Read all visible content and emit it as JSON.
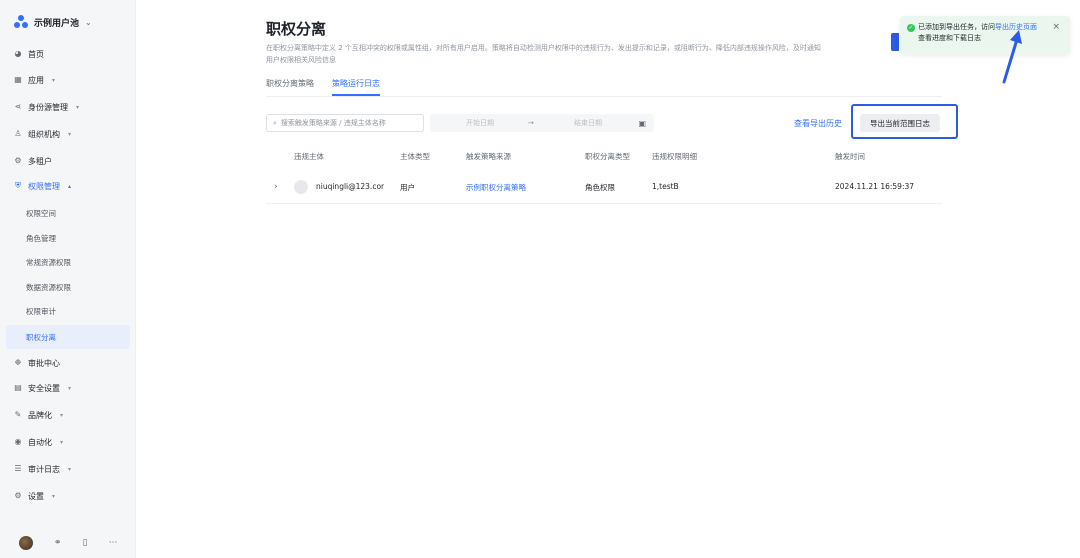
{
  "sidebar": {
    "brand": "示例用户池",
    "items": [
      {
        "label": "首页"
      },
      {
        "label": "应用"
      },
      {
        "label": "身份源管理"
      },
      {
        "label": "组织机构"
      },
      {
        "label": "多租户"
      },
      {
        "label": "权限管理"
      },
      {
        "label": "审批中心"
      },
      {
        "label": "安全设置"
      },
      {
        "label": "品牌化"
      },
      {
        "label": "自动化"
      },
      {
        "label": "审计日志"
      },
      {
        "label": "设置"
      }
    ],
    "sub_items": [
      {
        "label": "权限空间"
      },
      {
        "label": "角色管理"
      },
      {
        "label": "常规资源权限"
      },
      {
        "label": "数据资源权限"
      },
      {
        "label": "权限审计"
      },
      {
        "label": "职权分离"
      }
    ],
    "footer_more": "···"
  },
  "page": {
    "title": "职权分离",
    "description": "在职权分离策略中定义 2 个互相冲突的权限或属性组，对所有用户启用。策略将自动检测用户权限中的违规行为、发出提示和记录，或阻断行为、降低内部违规操作风险，及时通知用户权限相关风险信息",
    "tabs": [
      {
        "label": "职权分离策略"
      },
      {
        "label": "策略运行日志"
      }
    ]
  },
  "filters": {
    "search_placeholder": "搜索触发策略来源 / 违规主体名称",
    "start_date_placeholder": "开始日期",
    "date_sep": "→",
    "end_date_placeholder": "结束日期",
    "view_history": "查看导出历史",
    "export_button": "导出当前范围日志"
  },
  "table": {
    "headers": [
      "违规主体",
      "主体类型",
      "触发策略来源",
      "职权分离类型",
      "违规权限明细",
      "触发时间"
    ],
    "rows": [
      {
        "subject": "niuqingli@123.cor",
        "type": "用户",
        "source": "示例职权分离策略",
        "sod_type": "角色权限",
        "detail": "1,testB",
        "time": "2024.11.21 16:59:37"
      }
    ]
  },
  "toast": {
    "line1_prefix": "已添加到导出任务，访问",
    "line1_link": "导出历史页面",
    "line2": "查看进度和下载日志"
  }
}
